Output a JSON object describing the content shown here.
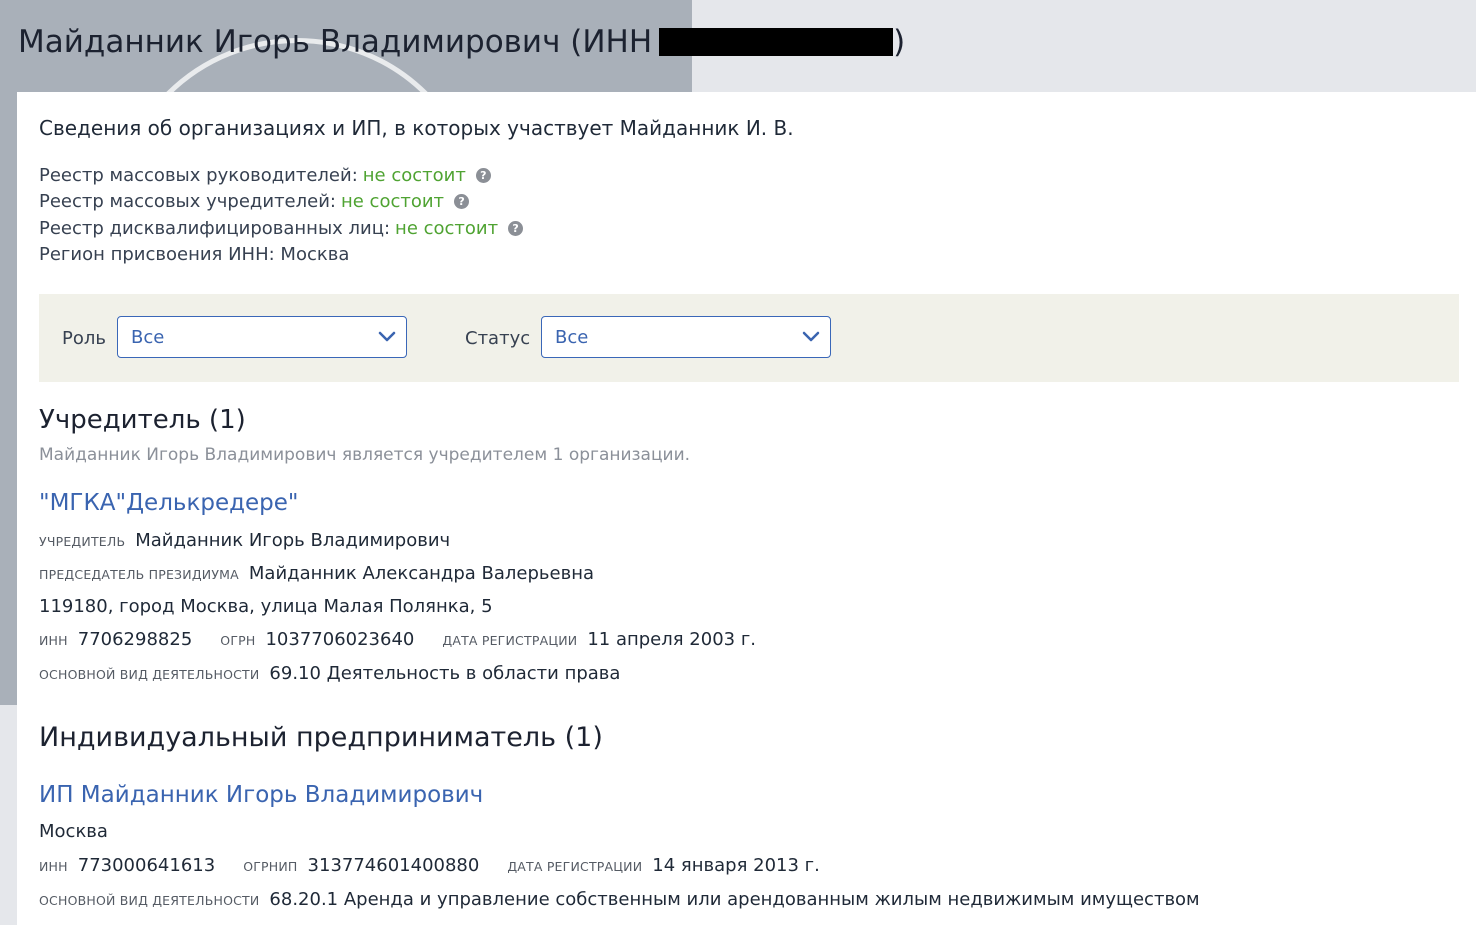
{
  "header": {
    "title": "Майданник Игорь Владимирович (ИНН",
    "title_close": ")"
  },
  "intro": {
    "heading": "Сведения об организациях и ИП, в которых участвует Майданник И. В.",
    "registries": [
      {
        "label": "Реестр массовых руководителей:",
        "value": "не состоит",
        "help": "?"
      },
      {
        "label": "Реестр массовых учредителей:",
        "value": "не состоит",
        "help": "?"
      },
      {
        "label": "Реестр дисквалифицированных лиц:",
        "value": "не состоит",
        "help": "?"
      }
    ],
    "region": "Регион присвоения ИНН: Москва"
  },
  "filters": {
    "role_label": "Роль",
    "role_value": "Все",
    "status_label": "Статус",
    "status_value": "Все"
  },
  "founder": {
    "heading": "Учредитель (1)",
    "note": "Майданник Игорь Владимирович является учредителем 1 организации.",
    "org": {
      "name": "\"МГКА\"Делькредере\"",
      "founder_caption": "учредитель",
      "founder_value": "Майданник Игорь Владимирович",
      "chair_caption": "председатель президиума",
      "chair_value": "Майданник Александра Валерьевна",
      "address": "119180, город Москва, улица Малая Полянка, 5",
      "inn_caption": "ИНН",
      "inn": "7706298825",
      "ogrn_caption": "ОГРН",
      "ogrn": "1037706023640",
      "reg_caption": "дата регистрации",
      "reg_date": "11 апреля 2003 г.",
      "activity_caption": "основной вид деятельности",
      "activity": "69.10 Деятельность в области права"
    }
  },
  "ip": {
    "heading": "Индивидуальный предприниматель (1)",
    "entry": {
      "name": "ИП Майданник Игорь Владимирович",
      "city": "Москва",
      "inn_caption": "ИНН",
      "inn": "773000641613",
      "ogrnip_caption": "ОГРНИП",
      "ogrnip": "313774601400880",
      "reg_caption": "дата регистрации",
      "reg_date": "14 января 2013 г.",
      "activity_caption": "основной вид деятельности",
      "activity": "68.20.1 Аренда и управление собственным или арендованным жилым недвижимым имуществом"
    }
  },
  "colors": {
    "link": "#3a64b0",
    "ok": "#4fa332",
    "filter_bg": "#f1f1e9"
  },
  "icons": {
    "help": "question-circle-icon",
    "dropdown": "chevron-down-icon"
  }
}
